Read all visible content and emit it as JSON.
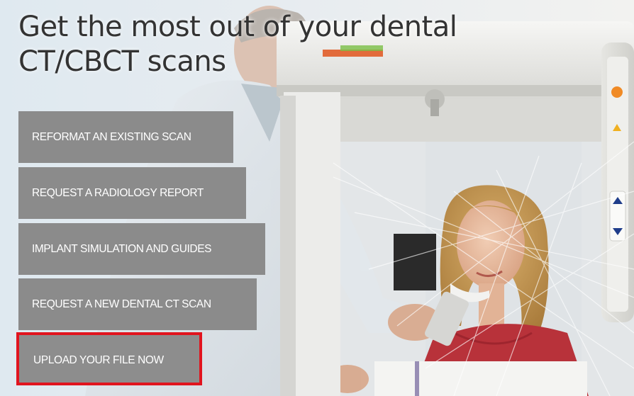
{
  "hero": {
    "title_line_1": "Get the most out of your dental",
    "title_line_2": "CT/CBCT scans"
  },
  "menu": {
    "items": [
      {
        "label": "REFORMAT AN EXISTING SCAN"
      },
      {
        "label": "REQUEST A RADIOLOGY REPORT"
      },
      {
        "label": "IMPLANT SIMULATION AND GUIDES"
      },
      {
        "label": "REQUEST A NEW DENTAL CT SCAN"
      },
      {
        "label": "UPLOAD YOUR FILE NOW",
        "highlighted": true
      }
    ]
  },
  "colors": {
    "button_bg": "#8b8b8b",
    "button_text": "#ffffff",
    "highlight_border": "#e1141e",
    "title_text": "#333333"
  }
}
